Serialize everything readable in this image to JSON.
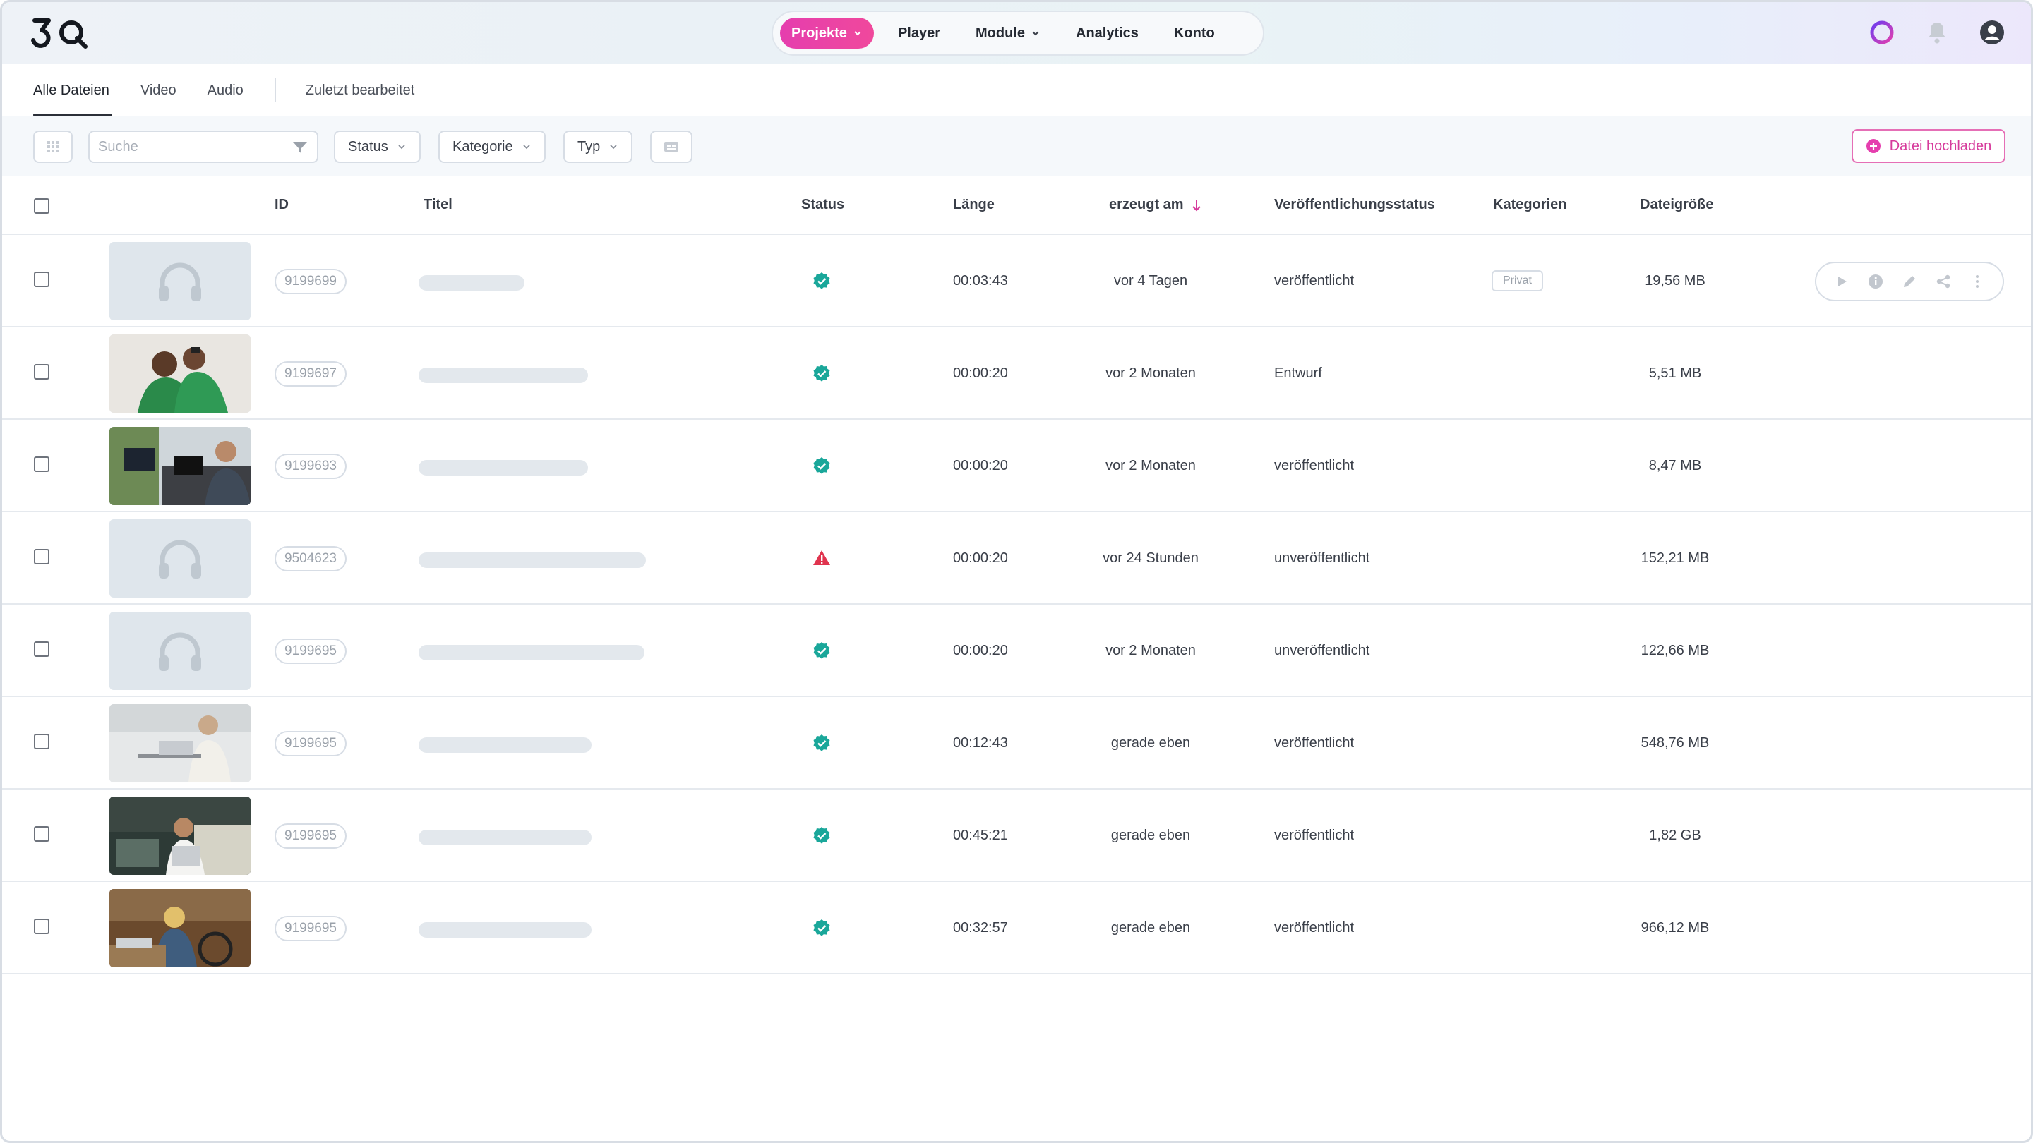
{
  "colors": {
    "accent": "#e53eae",
    "status_ok": "#1aa79a",
    "status_error": "#e0344e",
    "upload_border": "#e56fb6"
  },
  "nav": {
    "logo_text": "3Q",
    "items": [
      {
        "label": "Projekte",
        "active": true,
        "has_dropdown": true
      },
      {
        "label": "Player",
        "active": false,
        "has_dropdown": false
      },
      {
        "label": "Module",
        "active": false,
        "has_dropdown": true
      },
      {
        "label": "Analytics",
        "active": false,
        "has_dropdown": false
      },
      {
        "label": "Konto",
        "active": false,
        "has_dropdown": false
      }
    ],
    "icons": [
      "ring-icon",
      "bell-icon",
      "user-account-icon"
    ]
  },
  "tabs": [
    {
      "label": "Alle Dateien",
      "active": true
    },
    {
      "label": "Video",
      "active": false
    },
    {
      "label": "Audio",
      "active": false
    },
    {
      "label": "Zuletzt bearbeitet",
      "active": false
    }
  ],
  "filters": {
    "search_placeholder": "Suche",
    "status_label": "Status",
    "category_label": "Kategorie",
    "type_label": "Typ",
    "upload_label": "Datei hochladen"
  },
  "table": {
    "headers": {
      "id": "ID",
      "title": "Titel",
      "status": "Status",
      "length": "Länge",
      "created": "erzeugt am",
      "publish_status": "Veröffentlichungsstatus",
      "categories": "Kategorien",
      "filesize": "Dateigröße"
    },
    "sort": {
      "column": "created",
      "direction": "desc"
    },
    "rows": [
      {
        "thumb": "audio",
        "id": "9199699",
        "status": "ok",
        "length": "00:03:43",
        "created": "vor 4 Tagen",
        "publish": "veröffentlicht",
        "category": "Privat",
        "size": "19,56 MB",
        "show_actions": true
      },
      {
        "thumb": "photo-people-green",
        "id": "9199697",
        "status": "ok",
        "length": "00:00:20",
        "created": "vor 2 Monaten",
        "publish": "Entwurf",
        "category": "",
        "size": "5,51 MB",
        "show_actions": false
      },
      {
        "thumb": "photo-office-desk",
        "id": "9199693",
        "status": "ok",
        "length": "00:00:20",
        "created": "vor 2 Monaten",
        "publish": "veröffentlicht",
        "category": "",
        "size": "8,47 MB",
        "show_actions": false
      },
      {
        "thumb": "audio",
        "id": "9504623",
        "status": "error",
        "length": "00:00:20",
        "created": "vor 24 Stunden",
        "publish": "unveröffentlicht",
        "category": "",
        "size": "152,21 MB",
        "show_actions": false
      },
      {
        "thumb": "audio",
        "id": "9199695",
        "status": "ok",
        "length": "00:00:20",
        "created": "vor 2 Monaten",
        "publish": "unveröffentlicht",
        "category": "",
        "size": "122,66 MB",
        "show_actions": false
      },
      {
        "thumb": "photo-woman-laptop",
        "id": "9199695",
        "status": "ok",
        "length": "00:12:43",
        "created": "gerade eben",
        "publish": "veröffentlicht",
        "category": "",
        "size": "548,76 MB",
        "show_actions": false
      },
      {
        "thumb": "photo-cafe-laptop",
        "id": "9199695",
        "status": "ok",
        "length": "00:45:21",
        "created": "gerade eben",
        "publish": "veröffentlicht",
        "category": "",
        "size": "1,82 GB",
        "show_actions": false
      },
      {
        "thumb": "photo-wheelchair-laptop",
        "id": "9199695",
        "status": "ok",
        "length": "00:32:57",
        "created": "gerade eben",
        "publish": "veröffentlicht",
        "category": "",
        "size": "966,12 MB",
        "show_actions": false
      }
    ],
    "row_action_icons": [
      "play-icon",
      "info-icon",
      "edit-icon",
      "share-icon",
      "more-vertical-icon"
    ]
  }
}
